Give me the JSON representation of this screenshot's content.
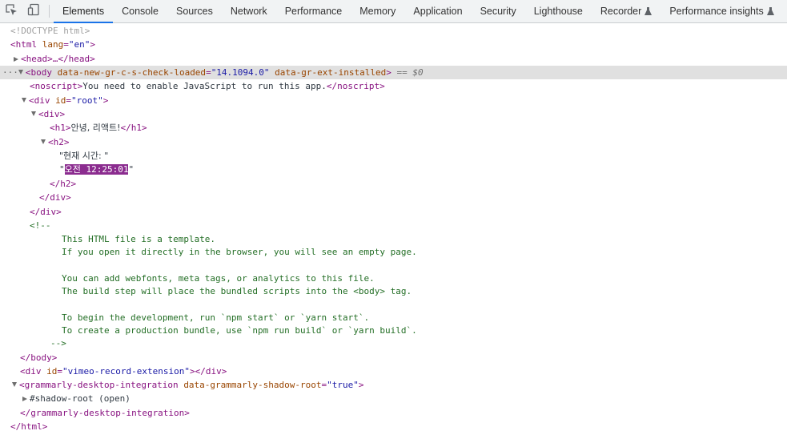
{
  "tabs": [
    {
      "label": "Elements",
      "active": true
    },
    {
      "label": "Console"
    },
    {
      "label": "Sources"
    },
    {
      "label": "Network"
    },
    {
      "label": "Performance"
    },
    {
      "label": "Memory"
    },
    {
      "label": "Application"
    },
    {
      "label": "Security"
    },
    {
      "label": "Lighthouse"
    },
    {
      "label": "Recorder",
      "flask": true
    },
    {
      "label": "Performance insights",
      "flask": true
    }
  ],
  "tree": {
    "doctype": "<!DOCTYPE html>",
    "html_open_tag": "<html",
    "html_lang_attr": "lang",
    "html_lang_val": "\"en\"",
    "head_collapsed": "<head>…</head>",
    "body_tag": "<body",
    "body_attr1": "data-new-gr-c-s-check-loaded",
    "body_attr1_val": "\"14.1094.0\"",
    "body_attr2": "data-gr-ext-installed",
    "body_eq": "== $0",
    "noscript_open": "<noscript>",
    "noscript_text": "You need to enable JavaScript to run this app.",
    "noscript_close": "</noscript>",
    "root_div_tag": "<div",
    "root_div_attr": "id",
    "root_div_val": "\"root\"",
    "div_open": "<div>",
    "h1_open": "<h1>",
    "h1_text": "안녕, 리액트!",
    "h1_close": "</h1>",
    "h2_open": "<h2>",
    "h2_text1": "\"현재 시간: \"",
    "h2_text2": "오전 12:25:01",
    "h2_close": "</h2>",
    "div_close": "</div>",
    "comment_open": "<!--",
    "comment_lines": [
      "This HTML file is a template.",
      "If you open it directly in the browser, you will see an empty page.",
      "",
      "You can add webfonts, meta tags, or analytics to this file.",
      "The build step will place the bundled scripts into the <body> tag.",
      "",
      "To begin the development, run `npm start` or `yarn start`.",
      "To create a production bundle, use `npm run build` or `yarn build`."
    ],
    "comment_close": "-->",
    "body_close": "</body>",
    "vimeo_div_attr_val": "\"vimeo-record-extension\"",
    "grammarly_tag": "<grammarly-desktop-integration",
    "grammarly_attr": "data-grammarly-shadow-root",
    "grammarly_val": "\"true\"",
    "shadow_root": "#shadow-root (open)",
    "grammarly_close": "</grammarly-desktop-integration>",
    "html_close": "</html>"
  }
}
